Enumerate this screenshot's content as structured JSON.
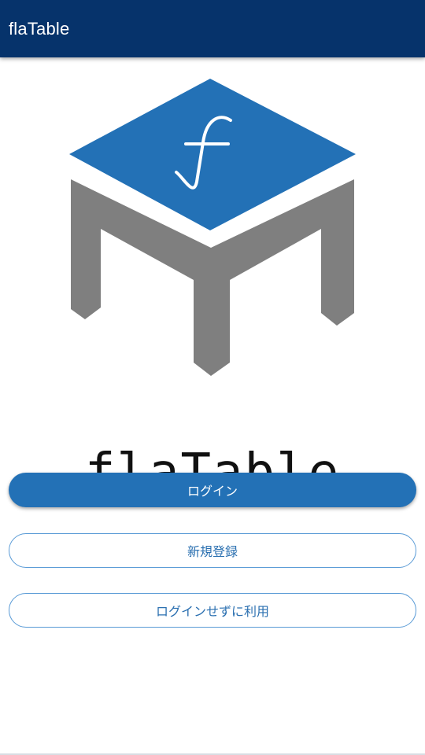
{
  "app_bar": {
    "title": "flaTable"
  },
  "logo": {
    "brand_text": "flaTable",
    "top_color": "#2371b6",
    "leg_color": "#7f7f7f",
    "glyph": "f"
  },
  "buttons": {
    "login_label": "ログイン",
    "register_label": "新規登録",
    "guest_label": "ログインせずに利用"
  },
  "colors": {
    "app_bar": "#06336b",
    "primary": "#2371b6",
    "outline": "#5a9bd6"
  }
}
